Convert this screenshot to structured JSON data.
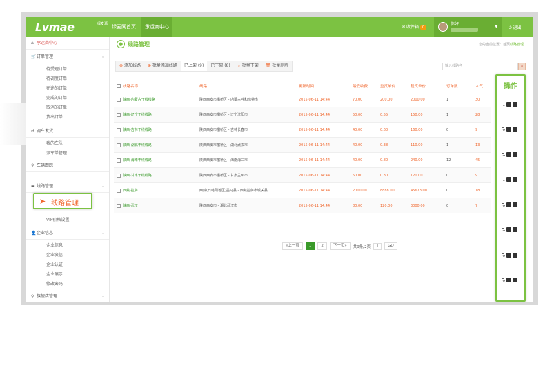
{
  "topbar": {
    "logo": "Lvmae",
    "logo_sub": "绿麦源",
    "nav_home": "绿麦网首页",
    "nav_center": "承运商中心",
    "inbox_label": "收件箱",
    "inbox_count": "0",
    "greeting": "你好：",
    "logout": "退出"
  },
  "sidebar": {
    "home": "承运商中心",
    "order_mgmt": "订单管理",
    "orders": [
      "待受理订单",
      "待调度订单",
      "在途的订单",
      "完成的订单",
      "取消的订单",
      "货出订单"
    ],
    "dispatch": "调车发货",
    "dispatch_items": [
      "我的车队",
      "派车单管理"
    ],
    "tracking": "车辆跟踪",
    "route_mgmt": "线路管理",
    "route_highlight": "线路管理",
    "vip_price": "VIP价格设置",
    "company_info": "企业信息",
    "company_items": [
      "企业信息",
      "企业资信",
      "企业认证",
      "企业展示",
      "修改密码"
    ],
    "flagship": "旗舰店管理"
  },
  "main": {
    "page_title": "线路管理",
    "breadcrumb_prefix": "您的当前位置：首页",
    "breadcrumb_current": "线路管理",
    "toolbar": {
      "add": "添加线路",
      "batch_add": "批量添加线路",
      "on_shelf": "已上架 (9)",
      "off_shelf": "已下架 (8)",
      "batch_off": "批量下架",
      "batch_delete": "批量删除"
    },
    "search_placeholder": "输入线路名",
    "actions_header": "操作"
  },
  "table": {
    "headers": {
      "name": "线路名称",
      "route": "线路",
      "time": "更新时间",
      "base": "最低收费",
      "heavy": "重货单价",
      "light": "轻货单价",
      "orders": "订单数",
      "popularity": "人气"
    },
    "rows": [
      {
        "name": "陕西-内蒙古干线线路",
        "route": "陕西西安市灞桥区 - 内蒙古呼和浩特市",
        "time": "2015-06-11 14:44",
        "base": "70.00",
        "heavy": "200.00",
        "light": "2000.00",
        "orders": "1",
        "pop": "30"
      },
      {
        "name": "陕西-辽宁干线线路",
        "route": "陕西西安市灞桥区 - 辽宁沈阳市",
        "time": "2015-06-11 14:44",
        "base": "50.00",
        "heavy": "0.55",
        "light": "150.00",
        "orders": "1",
        "pop": "28"
      },
      {
        "name": "陕西-吉林干线线路",
        "route": "陕西西安市灞桥区 - 吉林长春市",
        "time": "2015-06-11 14:44",
        "base": "40.00",
        "heavy": "0.60",
        "light": "160.00",
        "orders": "0",
        "pop": "9"
      },
      {
        "name": "陕西-湖北干线线路",
        "route": "陕西西安市灞桥区 - 湖北武汉市",
        "time": "2015-06-11 14:44",
        "base": "40.00",
        "heavy": "0.38",
        "light": "110.00",
        "orders": "1",
        "pop": "13"
      },
      {
        "name": "陕西-海南干线线路",
        "route": "陕西西安市灞桥区 - 海南海口市",
        "time": "2015-06-11 14:44",
        "base": "40.00",
        "heavy": "0.80",
        "light": "240.00",
        "orders": "12",
        "pop": "45"
      },
      {
        "name": "陕西-甘肃干线线路",
        "route": "陕西西安市灞桥区 - 甘肃兰州市",
        "time": "2015-06-11 14:44",
        "base": "50.00",
        "heavy": "0.30",
        "light": "120.00",
        "orders": "0",
        "pop": "9"
      },
      {
        "name": "西藏-拉萨",
        "route": "西藏(日喀则地区)墨马县 - 西藏拉萨市城关县",
        "time": "2015-06-11 14:44",
        "base": "2000.00",
        "heavy": "8888.00",
        "light": "45678.00",
        "orders": "0",
        "pop": "18"
      },
      {
        "name": "陕西-武汉",
        "route": "陕西西安市 - 湖北武汉市",
        "time": "2015-06-11 14:44",
        "base": "80.00",
        "heavy": "120.00",
        "light": "3000.00",
        "orders": "0",
        "pop": "7"
      }
    ]
  },
  "pager": {
    "prev": "«上一页",
    "page1": "1",
    "page2": "2",
    "next": "下一页»",
    "total": "共9条/2页",
    "input": "1",
    "go": "GO"
  }
}
